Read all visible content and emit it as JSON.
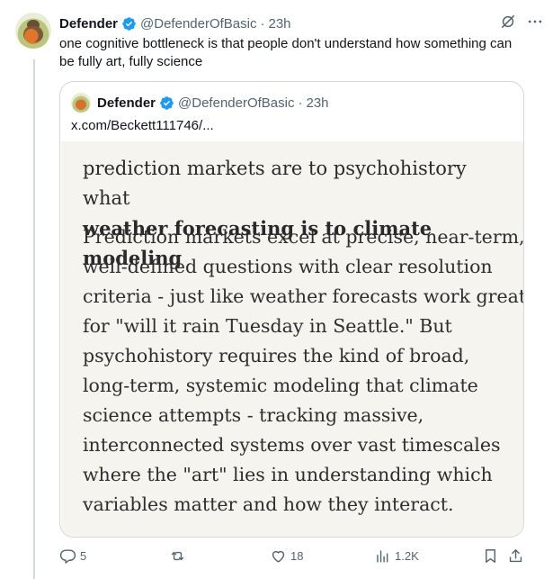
{
  "tweet": {
    "author_name": "Defender",
    "handle": "@DefenderOfBasic",
    "separator": "·",
    "time": "23h",
    "text": "one cognitive bottleneck is that people don't understand how something can be fully art, fully science"
  },
  "quote": {
    "author_name": "Defender",
    "handle": "@DefenderOfBasic",
    "separator": "·",
    "time": "23h",
    "link_text": "x.com/Beckett111746/...",
    "image": {
      "title_line1": "prediction markets are to psychohistory what",
      "title_line2": "weather forecasting is to climate modeling",
      "body_lines": [
        "Prediction markets excel at precise, near-term,",
        "well-defined questions with clear resolution",
        "criteria - just like weather forecasts work great",
        "for \"will it rain Tuesday in Seattle.\" But",
        "psychohistory requires the kind of broad,",
        "long-term, systemic modeling that climate",
        "science attempts - tracking massive,",
        "interconnected systems over vast timescales",
        "where the \"art\" lies in understanding which",
        "variables matter and how they interact."
      ]
    }
  },
  "actions": {
    "replies": "5",
    "reposts": "",
    "likes": "18",
    "views": "1.2K"
  },
  "icons": {
    "verified": "verified-badge-icon",
    "grok": "grok-icon",
    "more": "more-icon",
    "reply": "reply-icon",
    "repost": "repost-icon",
    "like": "heart-icon",
    "views": "views-icon",
    "bookmark": "bookmark-icon",
    "share": "share-icon"
  },
  "colors": {
    "verified_blue": "#1d9bf0",
    "secondary_text": "#536471",
    "border": "#cfd9de",
    "image_bg": "#f6f4ef"
  }
}
